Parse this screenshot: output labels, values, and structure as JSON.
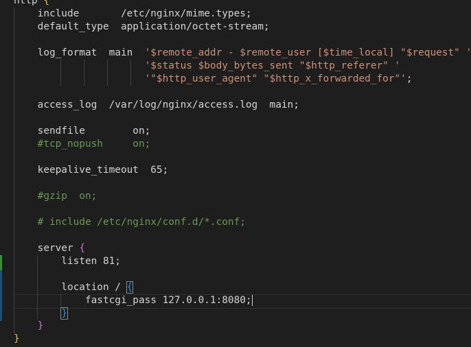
{
  "editor": {
    "lines": [
      {
        "key": "http_open",
        "a": "http ",
        "b": "{"
      },
      {
        "key": "include",
        "a": "    include       /etc/nginx/mime.types",
        "b": ";"
      },
      {
        "key": "default_type",
        "a": "    default_type  application/octet-stream",
        "b": ";"
      },
      {
        "key": "log_format_1",
        "a": "    log_format  main  ",
        "b": "'$remote_addr - $remote_user [$time_local] \"$request\" '"
      },
      {
        "key": "log_format_2",
        "a": "                      ",
        "b": "'$status $body_bytes_sent \"$http_referer\" '"
      },
      {
        "key": "log_format_3",
        "a": "                      ",
        "b": "'\"$http_user_agent\" \"$http_x_forwarded_for\"'",
        "c": ";"
      },
      {
        "key": "access_log",
        "a": "    access_log  /var/log/nginx/access.log  main",
        "b": ";"
      },
      {
        "key": "sendfile",
        "a": "    sendfile        on",
        "b": ";"
      },
      {
        "key": "tcp_nopush",
        "a": "    #tcp_nopush     on;"
      },
      {
        "key": "keepalive",
        "a": "    keepalive_timeout  65",
        "b": ";"
      },
      {
        "key": "gzip",
        "a": "    #gzip  on;"
      },
      {
        "key": "include_conf",
        "a": "    # include /etc/nginx/conf.d/*.conf;"
      },
      {
        "key": "server_open",
        "a": "    server ",
        "b": "{"
      },
      {
        "key": "listen",
        "a": "        listen 81",
        "b": ";"
      },
      {
        "key": "location_open",
        "a": "        location / ",
        "b": "{"
      },
      {
        "key": "fastcgi",
        "a": "            fastcgi_pass 127.0.0.1:8080",
        "b": ";"
      },
      {
        "key": "location_close",
        "a": "        ",
        "b": "}"
      },
      {
        "key": "server_close",
        "a": "    ",
        "b": "}"
      },
      {
        "key": "http_close",
        "a": "",
        "b": "}"
      }
    ],
    "colors": {
      "background": "#1e1e1e",
      "text": "#d4d4d4",
      "string": "#ce9178",
      "comment": "#6a9955",
      "brace_level1": "#e3c04a",
      "brace_level2": "#d16fd0",
      "brace_level3": "#1e90ff",
      "gutter_added": "#3a8f3a",
      "gutter_modified": "#1f4f77"
    }
  }
}
